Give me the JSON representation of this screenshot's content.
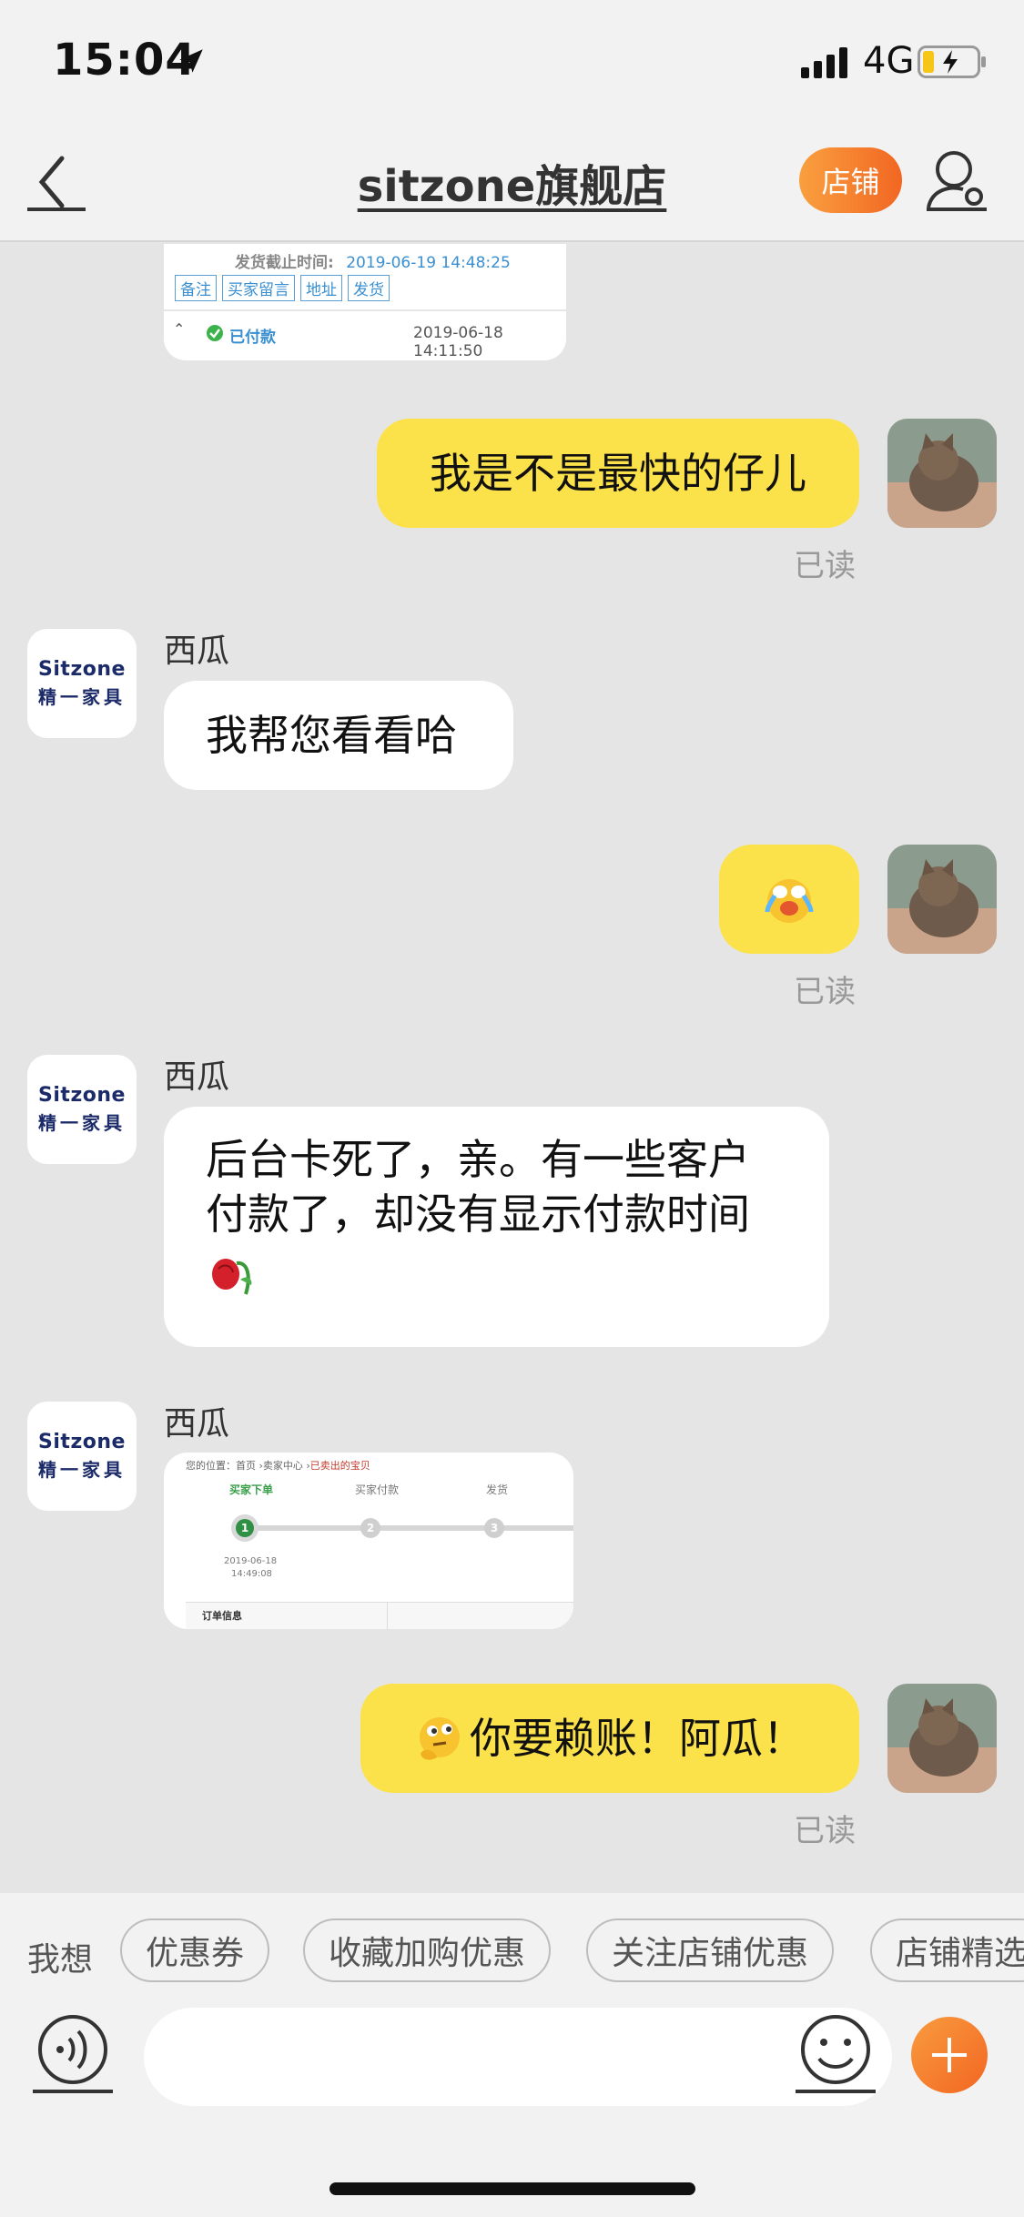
{
  "status_bar": {
    "time": "15:04",
    "network": "4G"
  },
  "header": {
    "title": "sitzone旗舰店",
    "shop_button": "店铺"
  },
  "colors": {
    "my_bubble": "#fce24a",
    "accent": "#f26622",
    "background": "#e5e5e5"
  },
  "order_card": {
    "deadline_label": "发货截止时间:",
    "deadline_value": "2019-06-19 14:48:25",
    "actions": [
      "备注",
      "买家留言",
      "地址",
      "发货"
    ],
    "status": "已付款",
    "timestamp": "2019-06-18 14:11:50"
  },
  "messages": {
    "m1": {
      "text": "我是不是最快的仔儿",
      "read": "已读"
    },
    "m2": {
      "sender": "西瓜",
      "text": "我帮您看看哈"
    },
    "m3": {
      "emoji": "cry-laugh-emoji",
      "read": "已读"
    },
    "m4": {
      "sender": "西瓜",
      "line1": "后台卡死了，亲。有一些客户",
      "line2": "付款了，却没有显示付款时间",
      "emoji": "wilted-rose-emoji"
    },
    "m5": {
      "sender": "西瓜"
    },
    "m6": {
      "text": "你要赖账！阿瓜！",
      "emoji": "thinking-face-emoji",
      "read": "已读"
    }
  },
  "shop_logo": {
    "brand": "Sitzone",
    "sub": "精一家具"
  },
  "progress_card": {
    "breadcrumb_prefix": "您的位置：首页 ›卖家中心 ›",
    "breadcrumb_current": "已卖出的宝贝",
    "steps": [
      "买家下单",
      "买家付款",
      "发货"
    ],
    "step_numbers": [
      "1",
      "2",
      "3"
    ],
    "current_step": 1,
    "step1_date": "2019-06-18",
    "step1_time": "14:49:08",
    "section_label": "订单信息"
  },
  "quick_replies": {
    "label": "我想",
    "chips": [
      "优惠券",
      "收藏加购优惠",
      "关注店铺优惠",
      "店铺精选"
    ]
  },
  "input": {
    "placeholder": ""
  }
}
